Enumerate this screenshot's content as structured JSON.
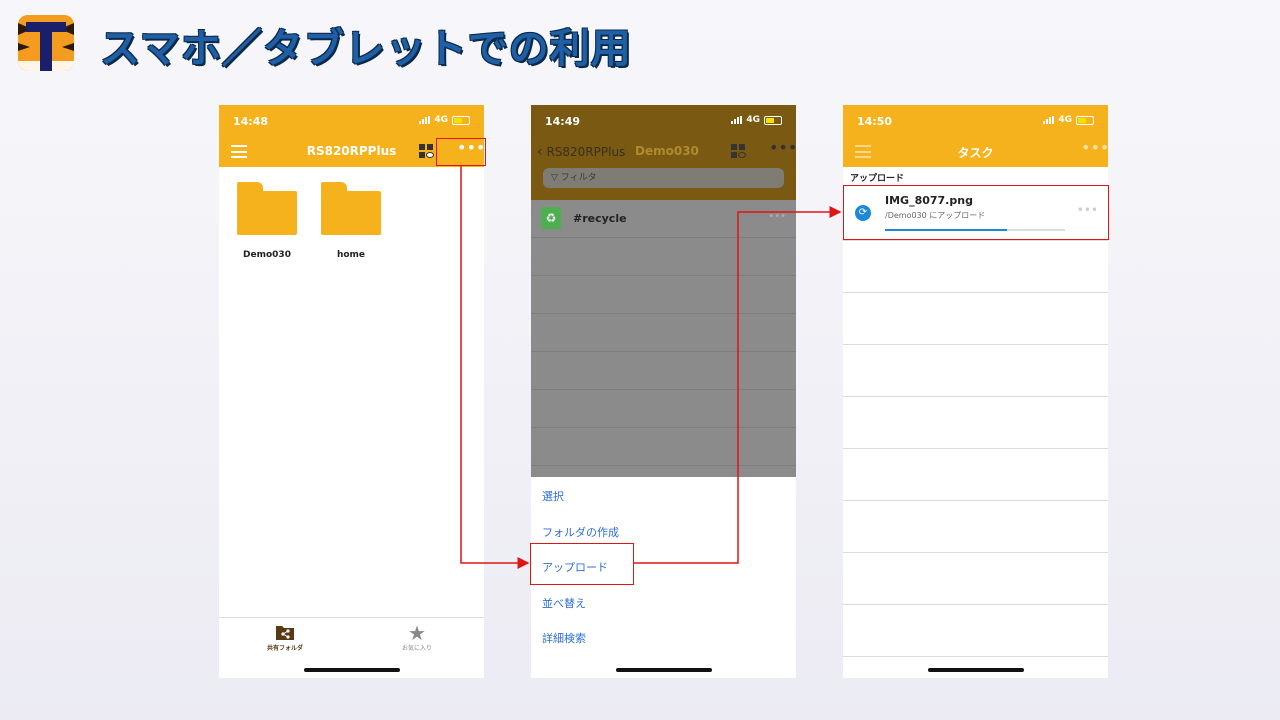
{
  "slide": {
    "title": "スマホ／タブレットでの利用",
    "logo_icon": "tiger-stripe-logo-icon"
  },
  "phone1": {
    "time": "14:48",
    "network": "4G",
    "nav_title": "RS820RPPlus",
    "folders": [
      {
        "label": "Demo030"
      },
      {
        "label": "home"
      }
    ],
    "tabs": [
      {
        "label": "共有フォルダ",
        "icon": "shared-folder-icon"
      },
      {
        "label": "お気に入り",
        "icon": "star-icon"
      }
    ]
  },
  "phone2": {
    "time": "14:49",
    "network": "4G",
    "back_label": "RS820RPPlus",
    "nav_title": "Demo030",
    "filter_placeholder": "フィルタ",
    "items": [
      {
        "label": "#recycle",
        "icon": "recycle-bin-icon"
      }
    ],
    "menu": [
      "選択",
      "フォルダの作成",
      "アップロード",
      "並べ替え",
      "詳細検索"
    ]
  },
  "phone3": {
    "time": "14:50",
    "network": "4G",
    "nav_title": "タスク",
    "section": "アップロード",
    "task": {
      "name": "IMG_8077.png",
      "dest": "/Demo030 にアップロード",
      "progress": 0.68
    }
  },
  "colors": {
    "accent": "#f5b21c",
    "highlight": "#e01515",
    "link": "#2f6fd1"
  }
}
